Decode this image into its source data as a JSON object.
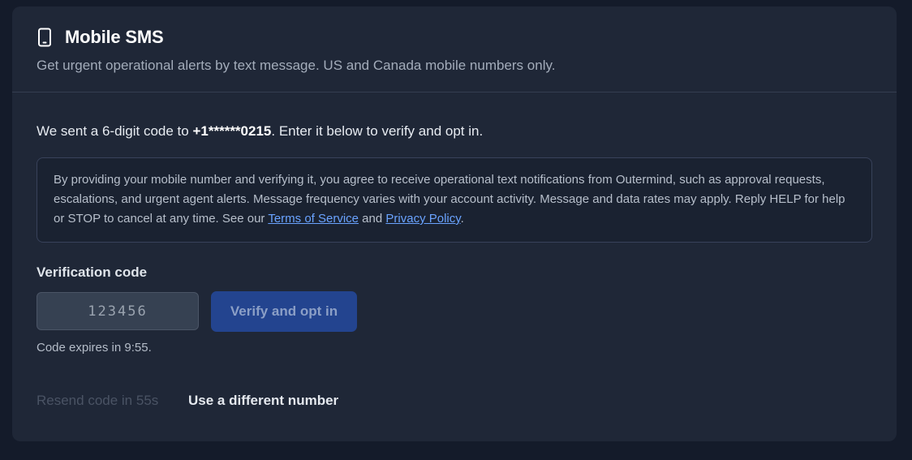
{
  "header": {
    "icon": "phone-icon",
    "title": "Mobile SMS",
    "subtitle": "Get urgent operational alerts by text message. US and Canada mobile numbers only."
  },
  "intro": {
    "prefix": "We sent a 6-digit code to ",
    "masked_number": "+1******0215",
    "suffix": ". Enter it below to verify and opt in."
  },
  "consent": {
    "text": "By providing your mobile number and verifying it, you agree to receive operational text notifications from Outermind, such as approval requests, escalations, and urgent agent alerts. Message frequency varies with your account activity. Message and data rates may apply. Reply HELP for help or STOP to cancel at any time. See our ",
    "terms_link": "Terms of Service",
    "and": " and ",
    "privacy_link": "Privacy Policy",
    "end": "."
  },
  "verification": {
    "label": "Verification code",
    "placeholder": "123456",
    "value": "",
    "verify_button": "Verify and opt in",
    "expires": "Code expires in 9:55."
  },
  "actions": {
    "resend": "Resend code in 55s",
    "different_number": "Use a different number"
  },
  "colors": {
    "page_bg": "#141b2a",
    "card_bg": "#1f2737",
    "accent": "#23448f",
    "link": "#6aa3ff"
  }
}
